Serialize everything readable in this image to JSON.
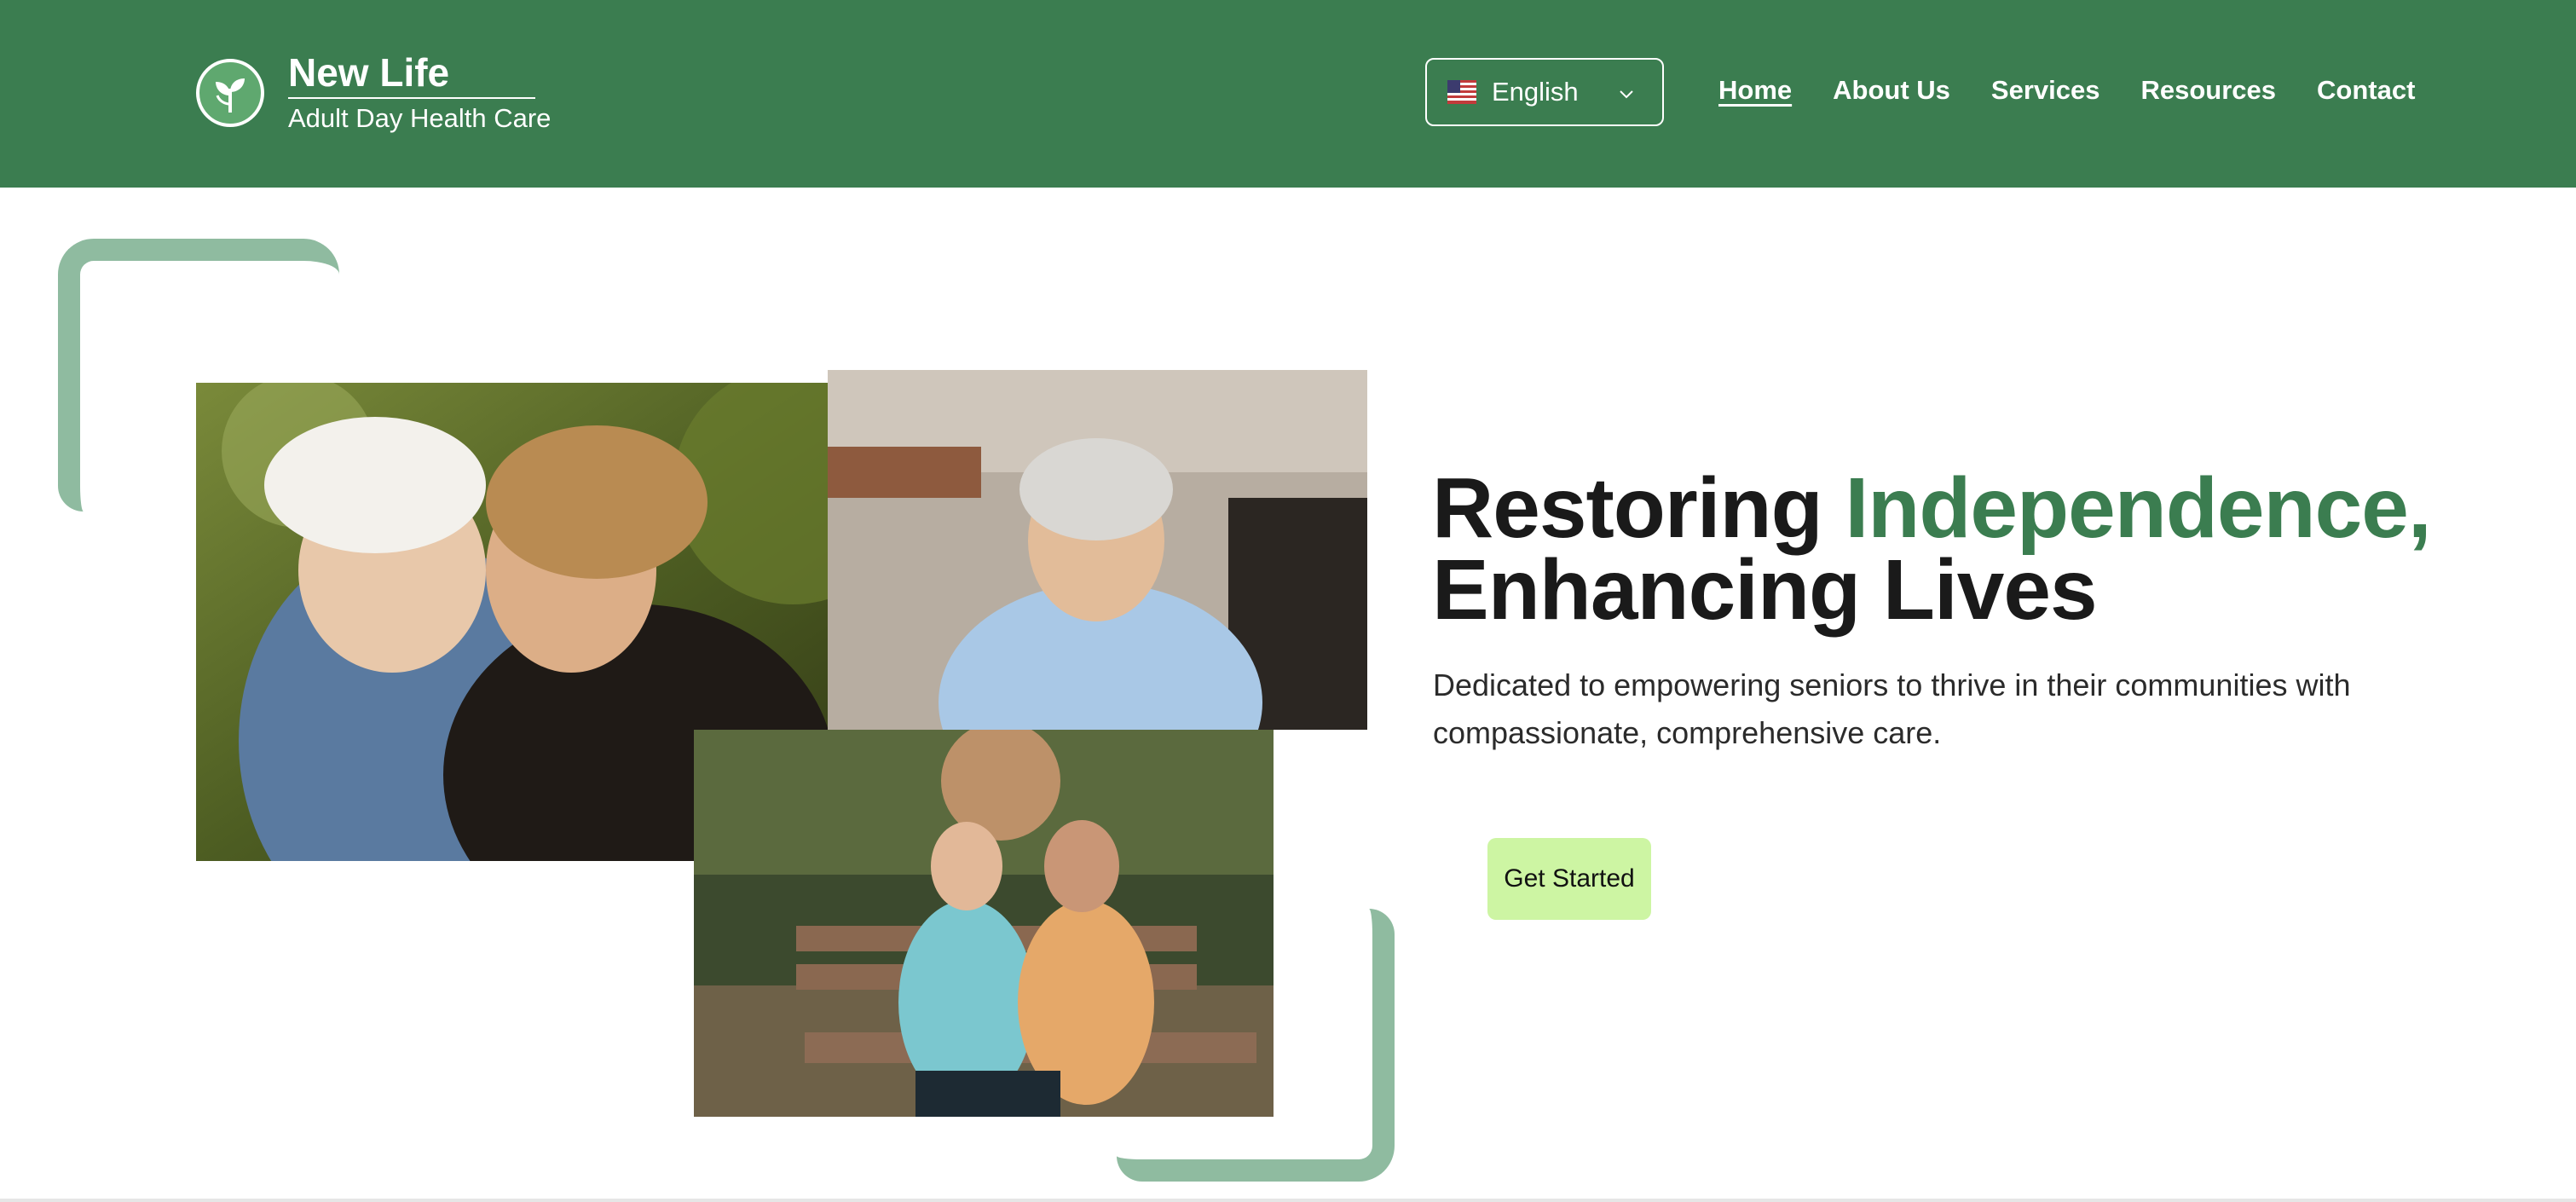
{
  "brand": {
    "logo_icon": "sprout-leaf-icon",
    "name": "New Life",
    "tagline": "Adult Day Health Care"
  },
  "language": {
    "flag_icon": "us-flag-icon",
    "selected": "English",
    "chevron_icon": "chevron-down-icon"
  },
  "nav": {
    "items": [
      {
        "label": "Home",
        "active": true
      },
      {
        "label": "About Us",
        "active": false
      },
      {
        "label": "Services",
        "active": false
      },
      {
        "label": "Resources",
        "active": false
      },
      {
        "label": "Contact",
        "active": false
      }
    ]
  },
  "hero": {
    "title_part1": "Restoring ",
    "title_accent": "Independence,",
    "title_part2": "Enhancing Lives",
    "subtitle": "Dedicated to empowering seniors to thrive in their communities with compassionate, comprehensive care.",
    "cta_label": "Get Started"
  },
  "colors": {
    "brand_green": "#3b7d50",
    "frame_green": "#8fbba0",
    "cta_bg": "#cdf5a3",
    "text_dark": "#1a1a1a"
  }
}
